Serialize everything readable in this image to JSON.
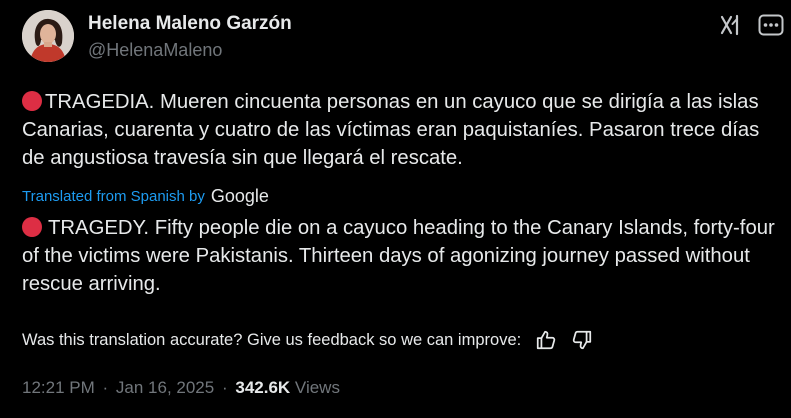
{
  "author": {
    "name": "Helena Maleno Garzón",
    "handle": "@HelenaMaleno",
    "avatar": "avatar-photo"
  },
  "toolbar": {
    "grok_icon": "grok-icon",
    "more_icon": "more-options-icon"
  },
  "post": {
    "original_text": "TRAGEDIA. Mueren cincuenta personas en un cayuco que se dirigía a las islas Canarias, cuarenta y cuatro de las víctimas eran paquistaníes. Pasaron trece días de angustiosa travesía sin que llegará el rescate.",
    "translated_label": "Translated from Spanish by",
    "translator_brand": "Google",
    "translated_text": "TRAGEDY. Fifty people die on a cayuco heading to the Canary Islands, forty-four of the victims were Pakistanis. Thirteen days of agonizing journey passed without rescue arriving.",
    "emoji_icon": "red-circle-icon"
  },
  "feedback": {
    "prompt": "Was this translation accurate? Give us feedback so we can improve:",
    "thumbs_up_icon": "thumbs-up-icon",
    "thumbs_down_icon": "thumbs-down-icon"
  },
  "meta": {
    "time": "12:21 PM",
    "separator": "·",
    "date": "Jan 16, 2025",
    "views_count": "342.6K",
    "views_label": "Views"
  },
  "colors": {
    "background": "#000000",
    "text_primary": "#e7e9ea",
    "text_secondary": "#71767b",
    "link_blue": "#1d9bf0",
    "emoji_red": "#dd2e44"
  }
}
